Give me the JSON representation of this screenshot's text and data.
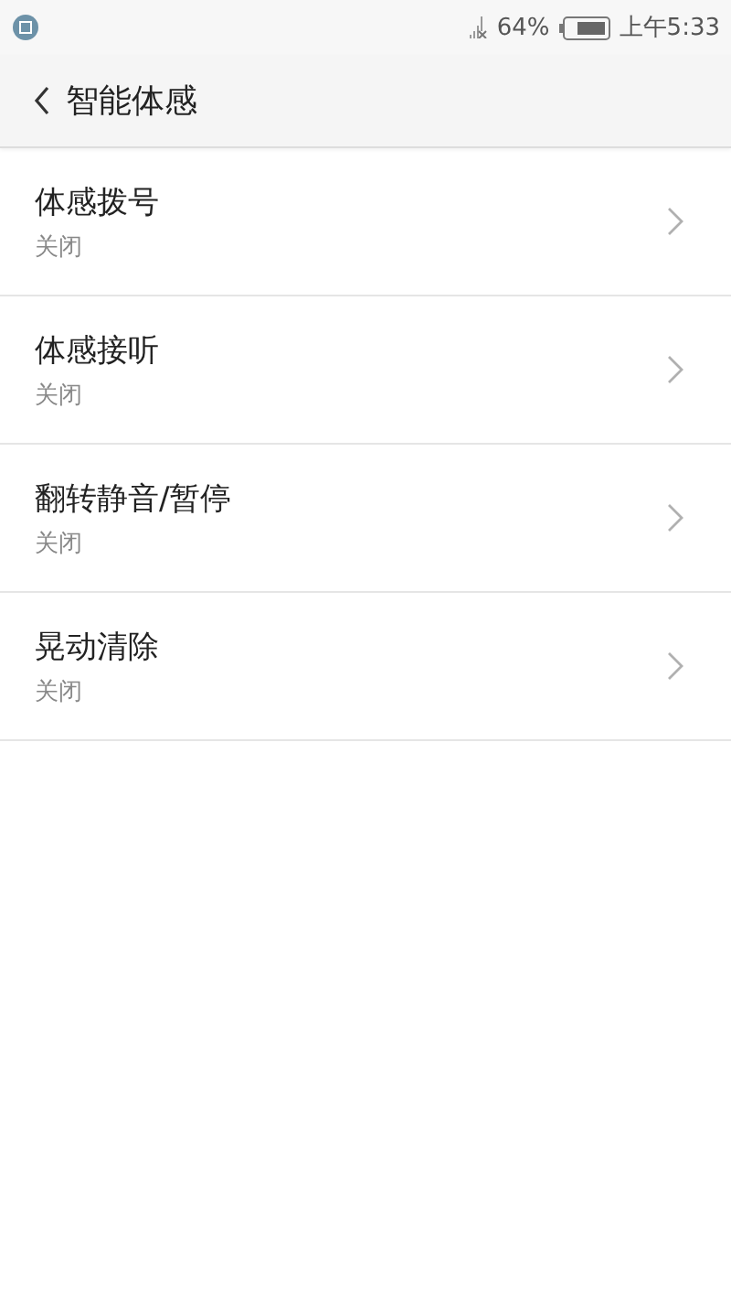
{
  "status_bar": {
    "battery_text": "64%",
    "time": "上午5:33"
  },
  "header": {
    "title": "智能体感"
  },
  "items": [
    {
      "title": "体感拨号",
      "status": "关闭"
    },
    {
      "title": "体感接听",
      "status": "关闭"
    },
    {
      "title": "翻转静音/暂停",
      "status": "关闭"
    },
    {
      "title": "晃动清除",
      "status": "关闭"
    }
  ]
}
